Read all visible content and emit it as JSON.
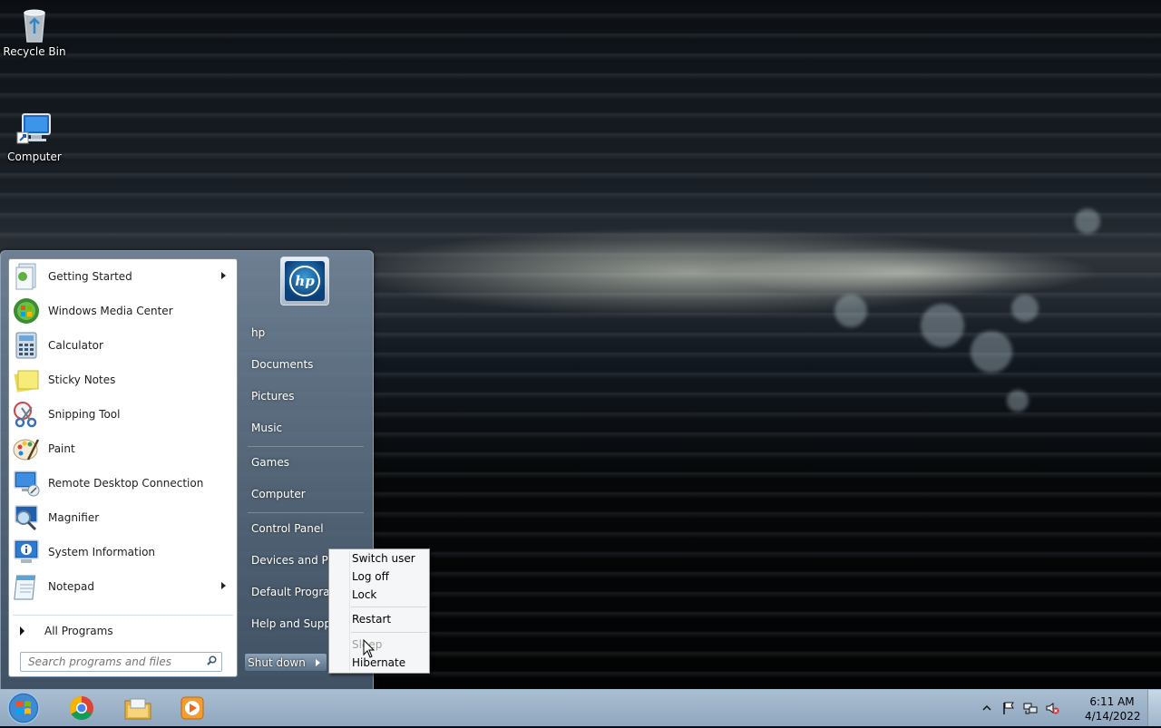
{
  "desktop": {
    "icons": [
      {
        "label": "Recycle Bin",
        "icon": "recycle-bin-icon"
      },
      {
        "label": "Computer",
        "icon": "computer-icon"
      }
    ]
  },
  "start_menu": {
    "programs": [
      {
        "label": "Getting Started",
        "icon": "getting-started-icon",
        "submenu": true
      },
      {
        "label": "Windows Media Center",
        "icon": "media-center-icon",
        "submenu": false
      },
      {
        "label": "Calculator",
        "icon": "calculator-icon",
        "submenu": false
      },
      {
        "label": "Sticky Notes",
        "icon": "sticky-notes-icon",
        "submenu": false
      },
      {
        "label": "Snipping Tool",
        "icon": "scissors-icon",
        "submenu": false
      },
      {
        "label": "Paint",
        "icon": "paint-icon",
        "submenu": false
      },
      {
        "label": "Remote Desktop Connection",
        "icon": "remote-desktop-icon",
        "submenu": false
      },
      {
        "label": "Magnifier",
        "icon": "magnifier-icon",
        "submenu": false
      },
      {
        "label": "System Information",
        "icon": "system-info-icon",
        "submenu": false
      },
      {
        "label": "Notepad",
        "icon": "notepad-icon",
        "submenu": true
      }
    ],
    "all_programs": "All Programs",
    "search_placeholder": "Search programs and files",
    "user_logo_text": "hp",
    "right_items": [
      {
        "label": "hp"
      },
      {
        "label": "Documents"
      },
      {
        "label": "Pictures"
      },
      {
        "label": "Music"
      },
      {
        "label": "Games"
      },
      {
        "label": "Computer"
      },
      {
        "label": "Control Panel"
      },
      {
        "label": "Devices and Printers"
      },
      {
        "label": "Default Programs"
      },
      {
        "label": "Help and Support"
      }
    ],
    "shutdown_label": "Shut down"
  },
  "power_menu": {
    "items": [
      "Switch user",
      "Log off",
      "Lock",
      "Restart",
      "Sleep",
      "Hibernate"
    ]
  },
  "taskbar": {
    "pinned": [
      "chrome-icon",
      "explorer-icon",
      "media-player-icon"
    ],
    "tray_icons": [
      "show-hidden-icon",
      "action-center-flag-icon",
      "network-icon",
      "volume-muted-icon"
    ],
    "time": "6:11 AM",
    "date": "4/14/2022"
  },
  "colors": {
    "accent": "#4a90d9",
    "taskbar": "#a8bed4"
  }
}
